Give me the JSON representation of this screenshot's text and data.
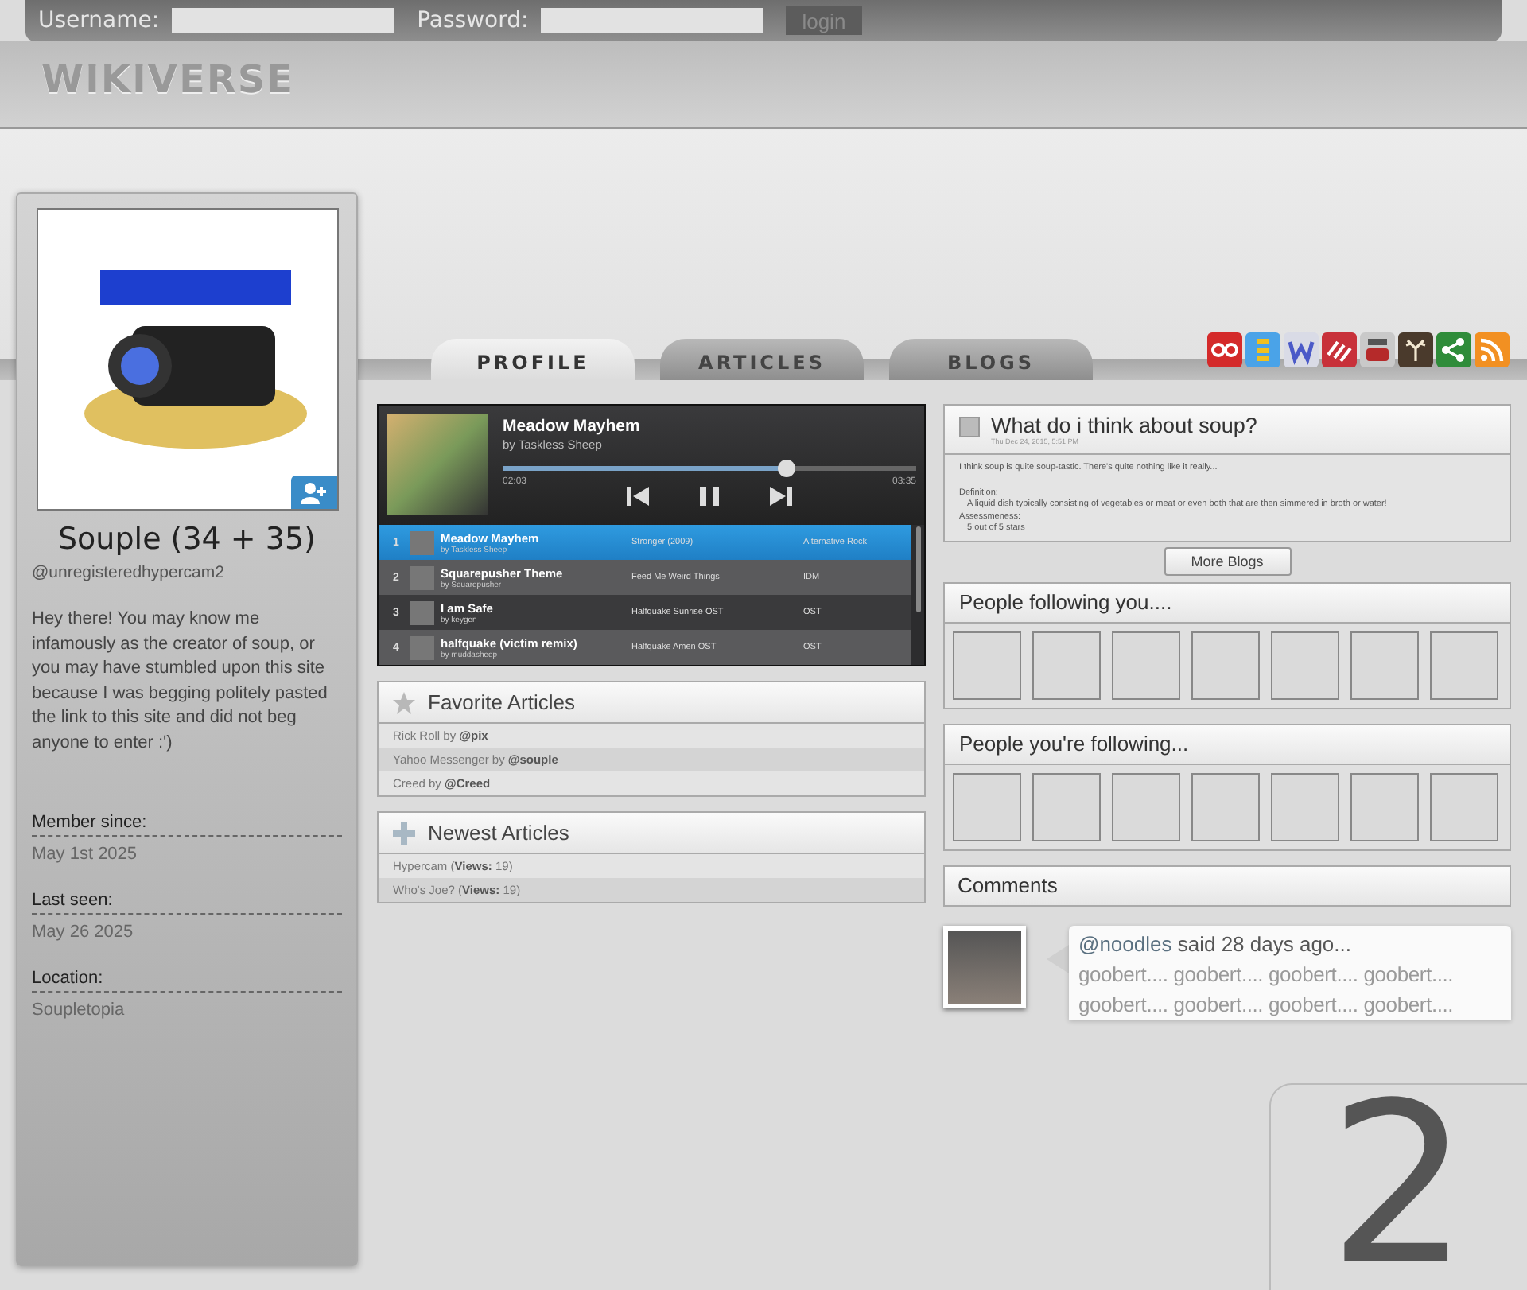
{
  "login_bar": {
    "username_label": "Username:",
    "password_label": "Password:",
    "button": "login"
  },
  "site_title": "WIKIVERSE",
  "profile": {
    "name": "Souple (34 + 35)",
    "handle": "@unregisteredhypercam2",
    "bio": "Hey there! You may know me infamously as the creator of soup, or you may have stumbled upon this site because I was begging politely pasted the link to this site and did not beg anyone to enter :')",
    "facts": [
      {
        "label": "Member since:",
        "value": "May 1st 2025"
      },
      {
        "label": "Last seen:",
        "value": "May 26 2025"
      },
      {
        "label": "Location:",
        "value": "Soupletopia"
      }
    ]
  },
  "tabs": [
    {
      "label": "PROFILE",
      "selected": true
    },
    {
      "label": "ARTICLES",
      "selected": false
    },
    {
      "label": "BLOGS",
      "selected": false
    }
  ],
  "social_icons": [
    {
      "kind": "circles",
      "color": "#d42a2a"
    },
    {
      "kind": "bars",
      "color": "#4aa3e8"
    },
    {
      "kind": "zigzag",
      "color": "#d9dbe6"
    },
    {
      "kind": "stripes",
      "color": "#c8313a"
    },
    {
      "kind": "screen",
      "color": "#c9c9c9"
    },
    {
      "kind": "antlers",
      "color": "#4a3a2c"
    },
    {
      "kind": "share",
      "color": "#2f8c3a"
    },
    {
      "kind": "rss",
      "color": "#f29022"
    }
  ],
  "player": {
    "title": "Meadow Mayhem",
    "artist": "by Taskless Sheep",
    "level": 0.69,
    "elapsed": "02:03",
    "total": "03:35",
    "playing": true,
    "tracks": [
      {
        "number": "1",
        "title": "Meadow Mayhem",
        "artist": "by Taskless Sheep",
        "album": "Stronger (2009)",
        "genre": "Alternative Rock",
        "selected": true
      },
      {
        "number": "2",
        "title": "Squarepusher Theme",
        "artist": "by Squarepusher",
        "album": "Feed Me Weird Things",
        "genre": "IDM",
        "selected": false
      },
      {
        "number": "3",
        "title": "I am Safe",
        "artist": "by keygen",
        "album": "Halfquake Sunrise OST",
        "genre": "OST",
        "selected": false
      },
      {
        "number": "4",
        "title": "halfquake (victim remix)",
        "artist": "by muddasheep",
        "album": "Halfquake Amen OST",
        "genre": "OST",
        "selected": false
      }
    ]
  },
  "favorite_articles": {
    "title": "Favorite Articles",
    "items": [
      "Rick Roll by **@pix**",
      "Yahoo Messenger by **@souple**",
      "Creed by **@Creed**"
    ]
  },
  "newest_articles": {
    "title": "Newest Articles",
    "items": [
      "Hypercam (**Views:** 19)",
      "Who's Joe? (**Views:** 19)"
    ]
  },
  "blog": {
    "title": "What do i think about soup?",
    "date": "Thu Dec 24, 2015, 5:51 PM",
    "intro": "I think soup is quite soup-tastic. There's quite nothing like it really...",
    "sections": [
      {
        "heading": "Definition:",
        "bullets": [
          "A liquid dish typically consisting of vegetables or meat or even both that are then simmered in broth or water!"
        ]
      },
      {
        "heading": "Assessmeness:",
        "bullets": [
          "5 out of 5 stars"
        ]
      }
    ],
    "more_button": "More Blogs"
  },
  "followers": {
    "title": "People following you...."
  },
  "following": {
    "title": "People you're following..."
  },
  "comments": {
    "title": "Comments",
    "items": [
      {
        "user": "@noodles",
        "meta": "said 28 days ago...",
        "lines": [
          "goobert.... goobert.... goobert.... goobert....",
          "goobert.... goobert.... goobert.... goobert...."
        ]
      }
    ]
  },
  "page_number": "2"
}
